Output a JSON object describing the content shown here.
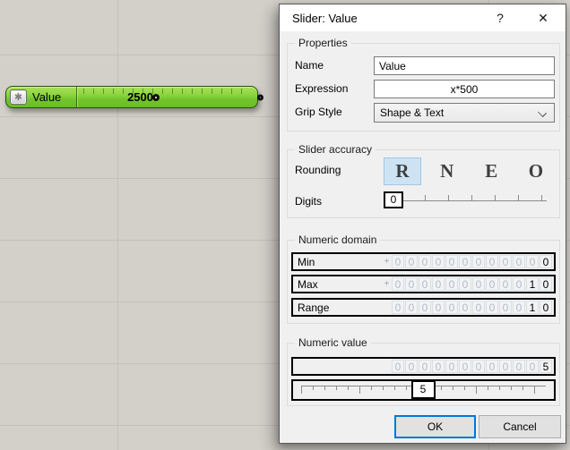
{
  "canvas": {
    "slider": {
      "name": "Value",
      "value": "2500",
      "asterisk_icon": "✱"
    }
  },
  "dialog": {
    "title": "Slider: Value",
    "help_icon": "?",
    "close_icon": "✕",
    "properties": {
      "legend": "Properties",
      "name_label": "Name",
      "name_value": "Value",
      "expression_label": "Expression",
      "expression_value": "x*500",
      "grip_style_label": "Grip Style",
      "grip_style_value": "Shape & Text"
    },
    "accuracy": {
      "legend": "Slider accuracy",
      "rounding_label": "Rounding",
      "rounding_options": [
        "R",
        "N",
        "E",
        "O"
      ],
      "rounding_selected": "R",
      "digits_label": "Digits",
      "digits_value": "0"
    },
    "domain": {
      "legend": "Numeric domain",
      "rows": [
        {
          "label": "Min",
          "sign": "+",
          "digits": "000000000000",
          "active_tail": 1
        },
        {
          "label": "Max",
          "sign": "+",
          "digits": "000000000010",
          "active_tail": 2
        },
        {
          "label": "Range",
          "sign": "",
          "digits": "000000000010",
          "active_tail": 2
        }
      ]
    },
    "numeric_value": {
      "legend": "Numeric value",
      "row": {
        "digits": "000000000005",
        "active_tail": 1
      },
      "slider_handle_value": "5"
    },
    "buttons": {
      "ok": "OK",
      "cancel": "Cancel"
    }
  },
  "colors": {
    "canvas_bg": "#d3d0c9",
    "slider_green": "#82cd37",
    "slider_border": "#26510a",
    "selected_blue_bg": "#cde3f4",
    "selected_blue_border": "#9ec7e8",
    "ok_focus_border": "#0078d7",
    "dialog_bg": "#f0f0f0"
  }
}
